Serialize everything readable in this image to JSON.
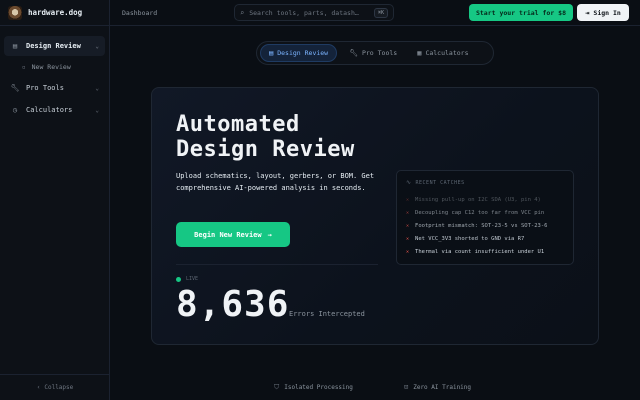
{
  "brand": {
    "name": "hardware.dog",
    "logo_icon": "dog-avatar-icon"
  },
  "sidebar": {
    "items": [
      {
        "label": "Design Review",
        "icon": "document-icon",
        "active": true,
        "expanded": true
      },
      {
        "label": "Pro Tools",
        "icon": "wrench-icon",
        "active": false,
        "expanded": false
      },
      {
        "label": "Calculators",
        "icon": "clock-icon",
        "active": false,
        "expanded": false
      }
    ],
    "subitems": [
      {
        "label": "New Review",
        "icon": "document-icon"
      }
    ],
    "collapse_label": "Collapse"
  },
  "topbar": {
    "breadcrumb": "Dashboard",
    "search": {
      "placeholder": "Search tools, parts, datash…",
      "shortcut": "⌘K"
    },
    "trial_button": "Start your trial for $8",
    "signin_button": "Sign In"
  },
  "tabs": [
    {
      "label": "Design Review",
      "icon": "document-icon",
      "active": true
    },
    {
      "label": "Pro Tools",
      "icon": "wrench-icon",
      "active": false
    },
    {
      "label": "Calculators",
      "icon": "calculator-icon",
      "active": false
    }
  ],
  "hero": {
    "title_line1": "Automated",
    "title_line2": "Design Review",
    "description": "Upload schematics, layout, gerbers, or BOM. Get comprehensive AI-powered analysis in seconds.",
    "cta": "Begin New Review",
    "live_label": "LIVE",
    "counter": "8,636",
    "counter_label": "Errors Intercepted"
  },
  "recent": {
    "title": "RECENT CATCHES",
    "items": [
      {
        "text": "Missing pull-up on I2C SDA (U3, pin 4)",
        "opacity": 0.35
      },
      {
        "text": "Decoupling cap C12 too far from VCC pin",
        "opacity": 0.6
      },
      {
        "text": "Footprint mismatch: SOT-23-5 vs SOT-23-6",
        "opacity": 0.8
      },
      {
        "text": "Net VCC_3V3 shorted to GND via R7",
        "opacity": 0.95
      },
      {
        "text": "Thermal via count insufficient under U1",
        "opacity": 1
      }
    ]
  },
  "footer": {
    "badges": [
      {
        "label": "Isolated Processing",
        "icon": "shield-icon"
      },
      {
        "label": "Zero AI Training",
        "icon": "lock-icon"
      }
    ]
  },
  "colors": {
    "accent_green": "#16c784",
    "tab_active_blue": "#7cb4ff",
    "error_red": "#e5534b",
    "background": "#0a0e14"
  }
}
